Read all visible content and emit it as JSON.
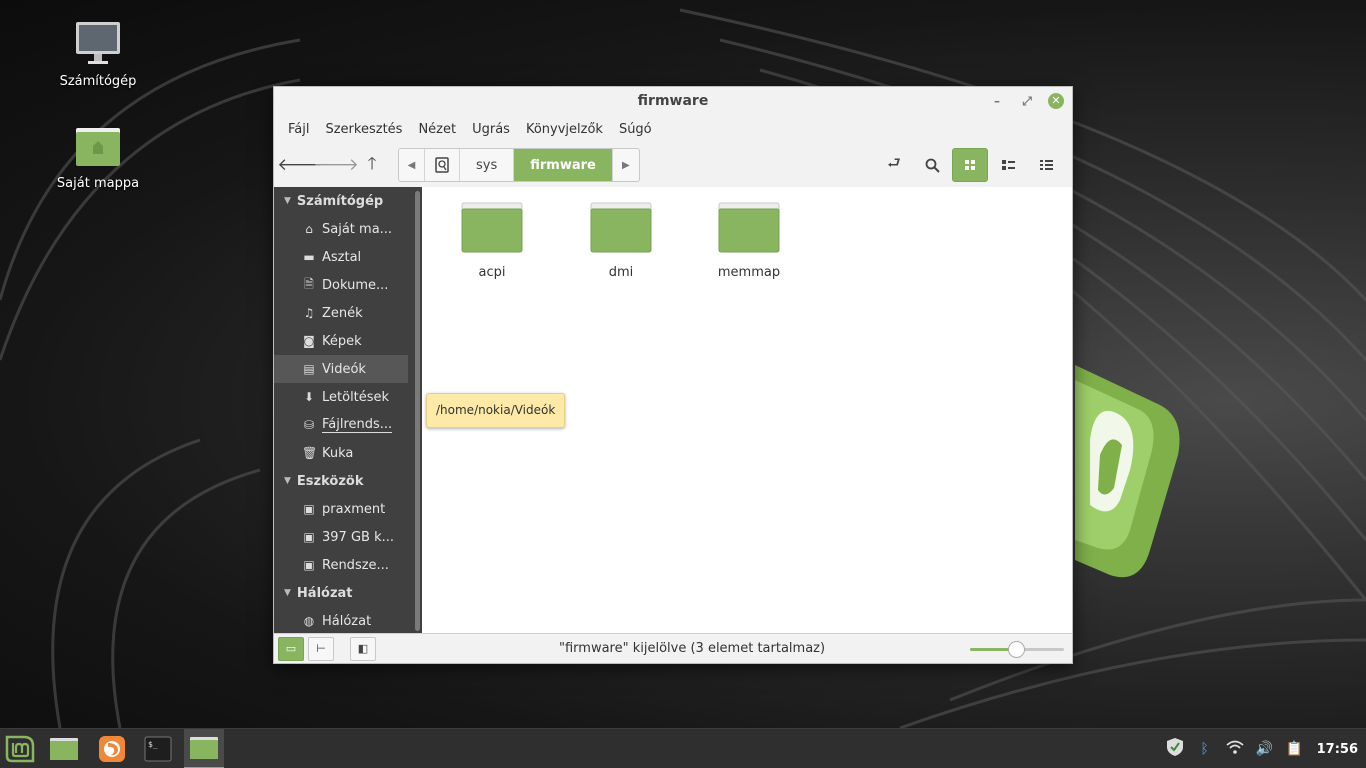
{
  "desktop": {
    "icons": [
      {
        "label": "Számítógép"
      },
      {
        "label": "Saját mappa"
      }
    ]
  },
  "window": {
    "title": "firmware",
    "menu": [
      "Fájl",
      "Szerkesztés",
      "Nézet",
      "Ugrás",
      "Könyvjelzők",
      "Súgó"
    ],
    "path": [
      "sys",
      "firmware"
    ],
    "sidebar": {
      "sections": [
        {
          "title": "Számítógép",
          "items": [
            "Saját ma...",
            "Asztal",
            "Dokume...",
            "Zenék",
            "Képek",
            "Videók",
            "Letöltések",
            "Fájlrends...",
            "Kuka"
          ]
        },
        {
          "title": "Eszközök",
          "items": [
            "praxment",
            "397 GB k...",
            "Rendsze..."
          ]
        },
        {
          "title": "Hálózat",
          "items": [
            "Hálózat"
          ]
        }
      ]
    },
    "files": [
      "acpi",
      "dmi",
      "memmap"
    ],
    "tooltip": "/home/nokia/Videók",
    "status": "\"firmware\" kijelölve (3 elemet tartalmaz)",
    "zoom_fraction": 0.5
  },
  "taskbar": {
    "clock": "17:56"
  },
  "colors": {
    "accent": "#8ab560",
    "sidebar_bg": "#404040",
    "tooltip_bg": "#fde9a8"
  }
}
